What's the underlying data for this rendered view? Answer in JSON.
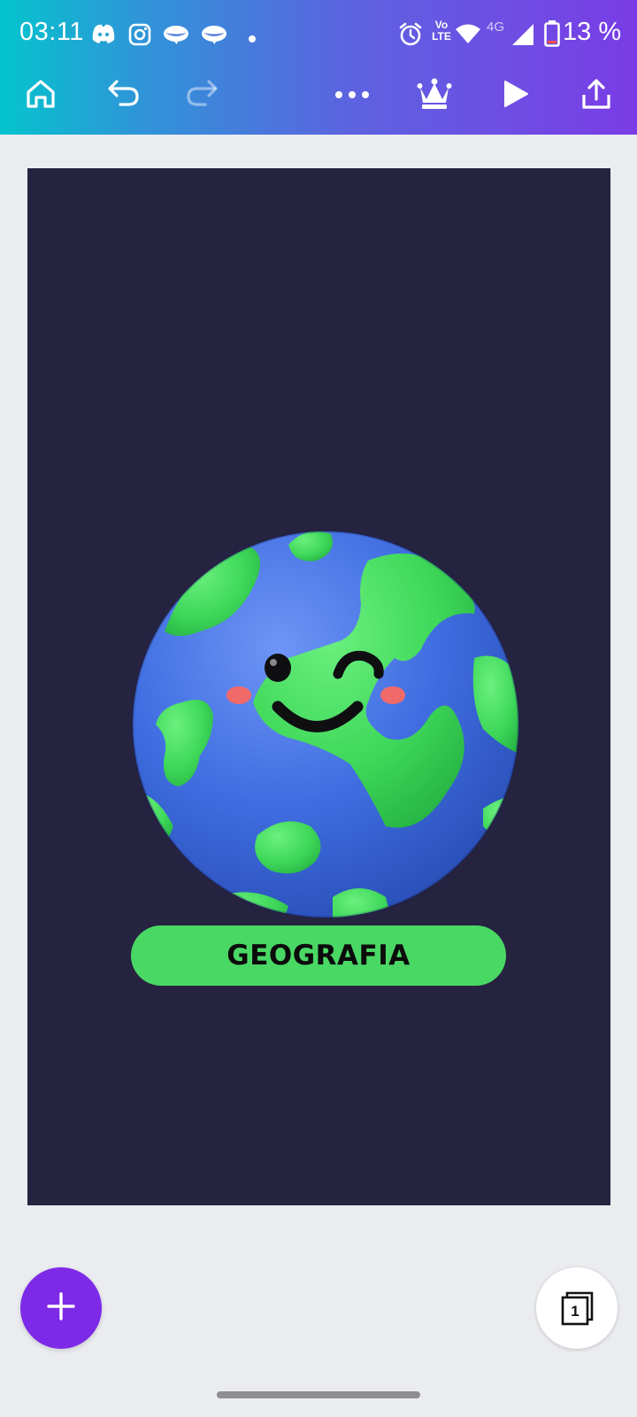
{
  "status_bar": {
    "time": "03:11",
    "network_type": "4G",
    "volte_label_top": "Vo",
    "volte_label_bottom": "LTE",
    "battery_percent": "13 %",
    "left_icons": [
      "discord-icon",
      "instagram-icon",
      "chat-bubble-icon",
      "chat-bubble-icon",
      "dot-icon"
    ],
    "right_icons": [
      "alarm-icon",
      "volte-icon",
      "wifi-icon",
      "signal-icon",
      "battery-icon"
    ]
  },
  "toolbar": {
    "home_icon": "home-icon",
    "undo_icon": "undo-icon",
    "redo_icon": "redo-icon",
    "more_icon": "more-options-icon",
    "premium_icon": "crown-icon",
    "present_icon": "play-icon",
    "share_icon": "share-icon"
  },
  "design": {
    "background_color": "#262340",
    "label": "GEOGRAFIA",
    "label_color": "#4ad865",
    "illustration": "smiling-earth-globe"
  },
  "bottom": {
    "add_icon": "plus-icon",
    "pages_icon": "pages-icon",
    "page_count": "1",
    "accent": "#7d2ae8"
  }
}
